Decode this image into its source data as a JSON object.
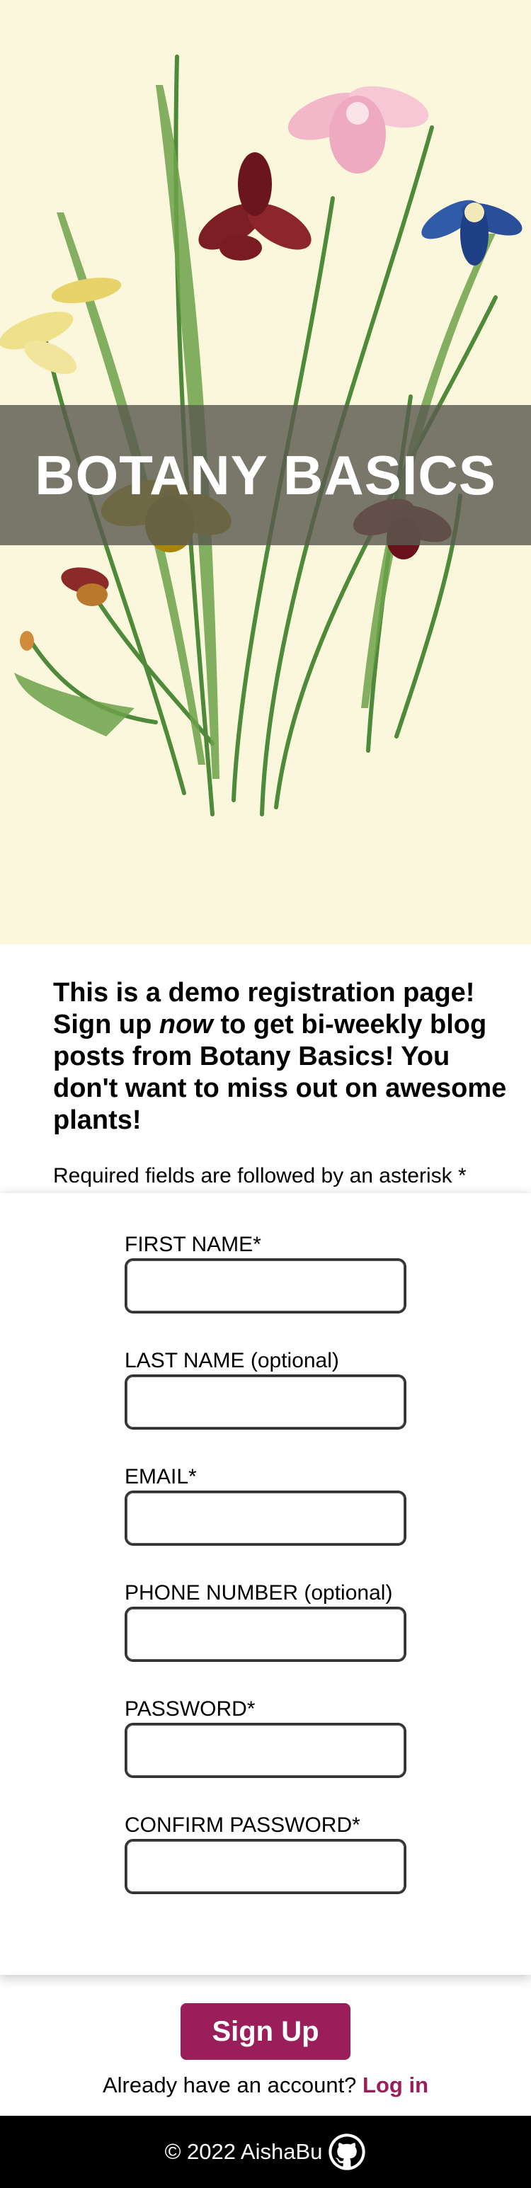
{
  "hero": {
    "title": "BOTANY BASICS",
    "image_alt": "botanical illustration of iris flowers"
  },
  "intro": {
    "heading_part1": "This is a demo registration page! Sign up ",
    "heading_em": "now",
    "heading_part2": " to get bi-weekly blog posts from Botany Basics! You don't want to miss out on awesome plants!",
    "required_note": "Required fields are followed by an asterisk *"
  },
  "form": {
    "fields": [
      {
        "label": "FIRST NAME*",
        "value": ""
      },
      {
        "label": "LAST NAME (optional)",
        "value": ""
      },
      {
        "label": "EMAIL*",
        "value": ""
      },
      {
        "label": "PHONE NUMBER (optional)",
        "value": ""
      },
      {
        "label": "PASSWORD*",
        "value": ""
      },
      {
        "label": "CONFIRM PASSWORD*",
        "value": ""
      }
    ]
  },
  "actions": {
    "signup_label": "Sign Up",
    "login_prompt": "Already have an account?",
    "login_link": "Log in"
  },
  "footer": {
    "text": "© 2022 AishaBu",
    "icon": "github-icon"
  },
  "colors": {
    "accent": "#9a1e5a",
    "hero_bg": "#fbf7dc",
    "footer_bg": "#000000"
  }
}
